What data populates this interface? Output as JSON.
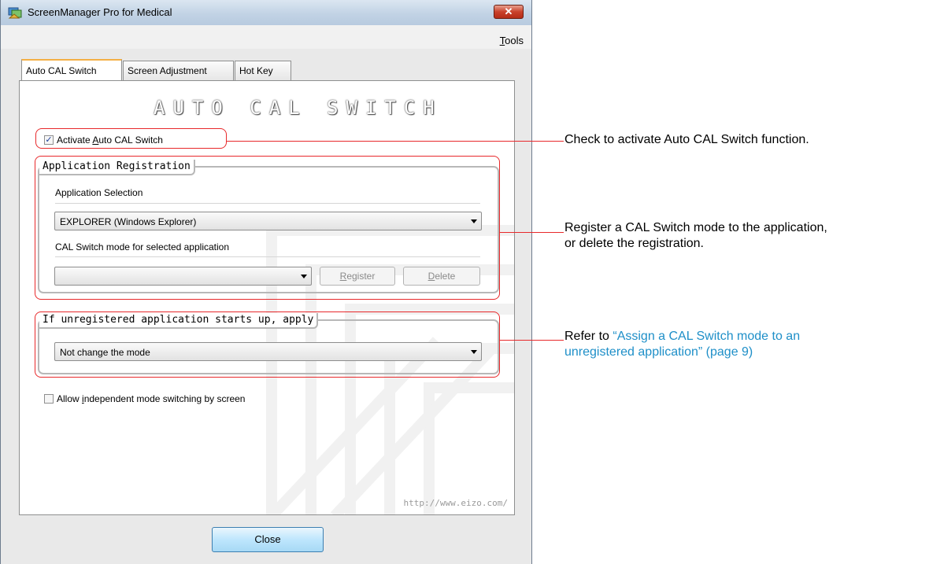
{
  "window": {
    "title": "ScreenManager Pro for Medical",
    "close_glyph": "✕",
    "menu": {
      "tools_mnemonic": "T",
      "tools_rest": "ools"
    }
  },
  "tabs": [
    {
      "label": "Auto CAL Switch",
      "active": true
    },
    {
      "label": "Screen Adjustment",
      "active": false
    },
    {
      "label": "Hot Key",
      "active": false
    }
  ],
  "panel": {
    "logo_text": "AUTO CAL SWITCH",
    "activate": {
      "checked": true,
      "pre": "Activate ",
      "mnemonic": "A",
      "post": "uto CAL Switch"
    },
    "registration": {
      "title": "Application Registration",
      "selection_label": "Application Selection",
      "selection_value": "EXPLORER (Windows Explorer)",
      "mode_label": "CAL Switch mode for selected application",
      "mode_value": "",
      "register_mnemonic": "R",
      "register_rest": "egister",
      "delete_mnemonic": "D",
      "delete_rest": "elete"
    },
    "unregistered": {
      "title": "If unregistered application starts up, apply",
      "value": "Not change the mode"
    },
    "independent": {
      "checked": false,
      "pre": "Allow ",
      "mnemonic": "i",
      "post": "ndependent mode switching by screen"
    },
    "url": "http://www.eizo.com/"
  },
  "close_button": "Close",
  "annotations": {
    "activate_note": "Check to activate Auto CAL Switch function.",
    "register_note_line1": "Register a CAL Switch mode to the application,",
    "register_note_line2": "or delete the registration.",
    "refer_prefix": "Refer to ",
    "refer_link_line1": "“Assign a CAL Switch mode to an",
    "refer_link_line2": "unregistered application” (page 9)"
  },
  "colors": {
    "highlight": "#e8292b",
    "link": "#1e8fc8",
    "active_tab_accent": "#f4b045"
  },
  "icons": [
    "app-icon",
    "close-icon",
    "checkbox-checked-icon",
    "dropdown-arrow-icon"
  ]
}
